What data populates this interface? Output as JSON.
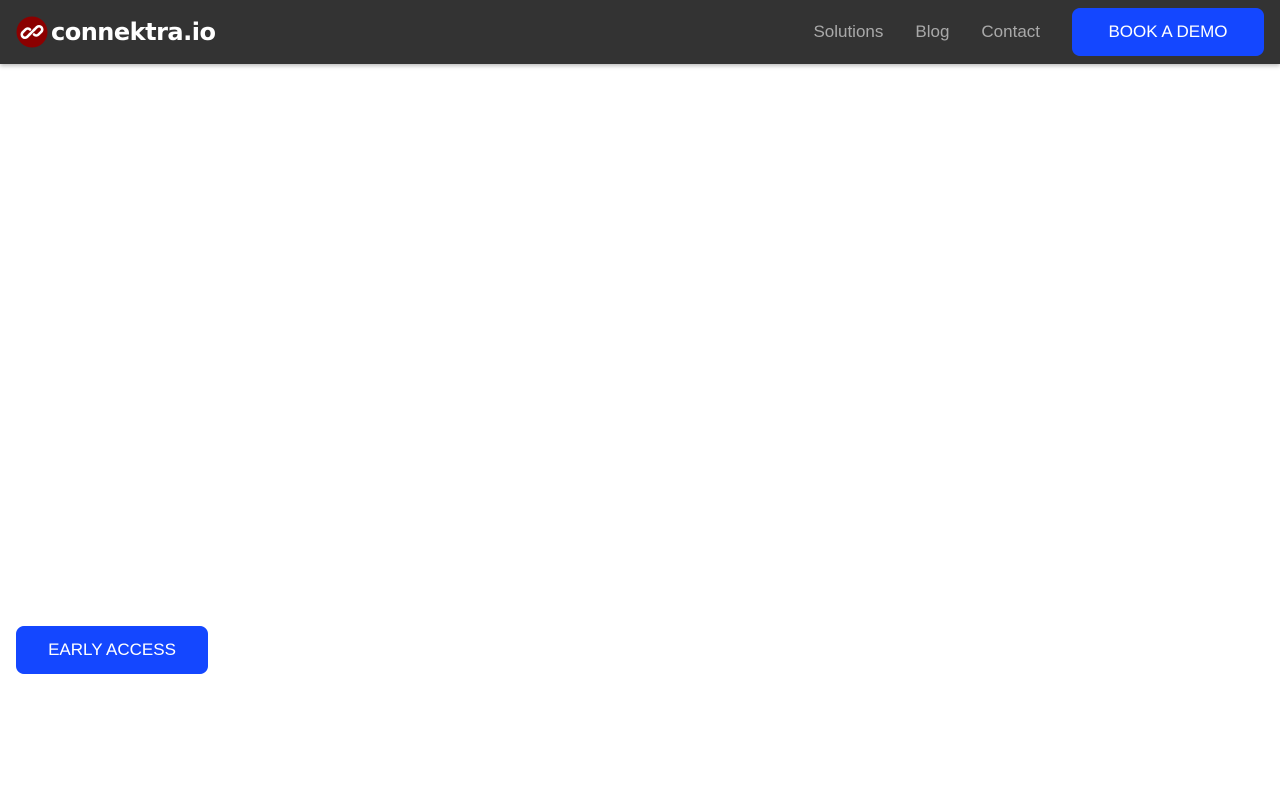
{
  "brand": {
    "name": "connektra.io",
    "logo_icon": "chain-link-icon",
    "logo_color": "#8b0000"
  },
  "nav": {
    "links": [
      {
        "label": "Solutions"
      },
      {
        "label": "Blog"
      },
      {
        "label": "Contact"
      }
    ],
    "cta_label": "BOOK A DEMO"
  },
  "hero": {
    "cta_label": "EARLY ACCESS"
  },
  "colors": {
    "navbar_bg": "#333333",
    "nav_link": "#a9a9a9",
    "accent": "#1447ff"
  }
}
